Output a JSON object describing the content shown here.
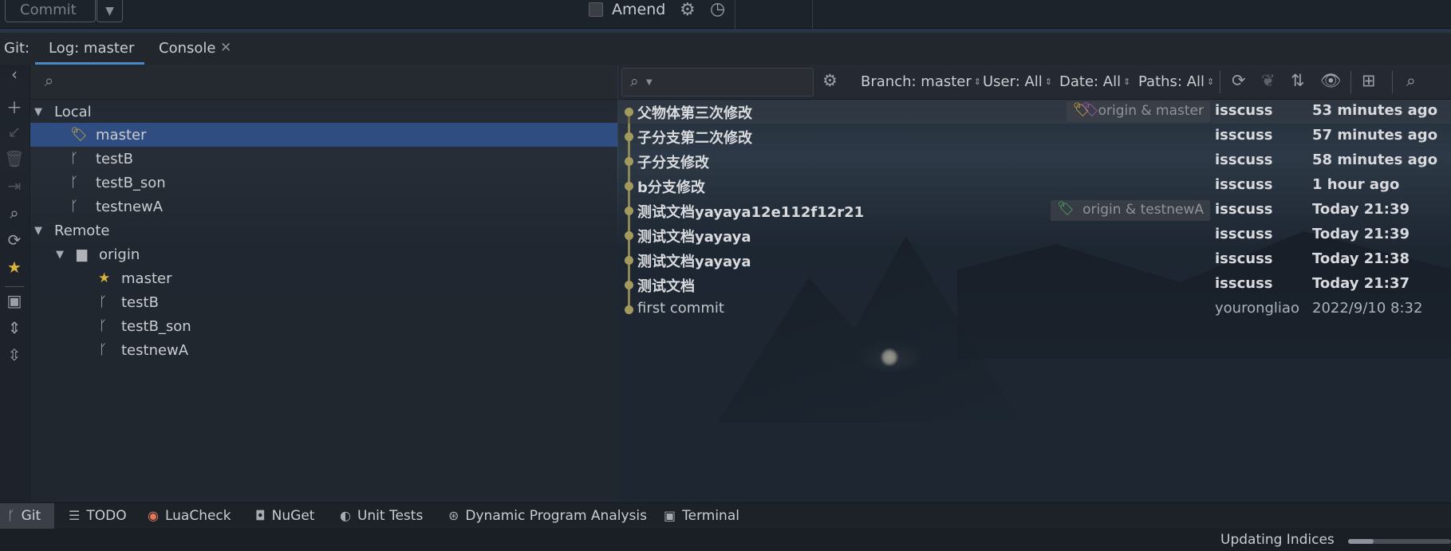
{
  "topbar": {
    "commit_label": "Commit",
    "amend_label": "Amend"
  },
  "tabs": {
    "git_label": "Git:",
    "items": [
      {
        "label": "Log: master",
        "active": true
      },
      {
        "label": "Console",
        "closable": true
      }
    ]
  },
  "branches": {
    "search_placeholder": "",
    "local_label": "Local",
    "local_items": [
      {
        "label": "master",
        "icon": "tag-icon",
        "selected": true
      },
      {
        "label": "testB",
        "icon": "branch-icon"
      },
      {
        "label": "testB_son",
        "icon": "branch-icon"
      },
      {
        "label": "testnewA",
        "icon": "branch-icon"
      }
    ],
    "remote_label": "Remote",
    "remote_group": "origin",
    "remote_items": [
      {
        "label": "master",
        "icon": "star-icon"
      },
      {
        "label": "testB",
        "icon": "branch-icon"
      },
      {
        "label": "testB_son",
        "icon": "branch-icon"
      },
      {
        "label": "testnewA",
        "icon": "branch-icon"
      }
    ]
  },
  "log_toolbar": {
    "branch_filter": "Branch: master",
    "user_filter": "User: All",
    "date_filter": "Date: All",
    "paths_filter": "Paths: All"
  },
  "commits": [
    {
      "message": "父物体第三次修改",
      "refs": "origin & master",
      "author": "isscuss",
      "date": "53 minutes ago",
      "bold": true
    },
    {
      "message": "子分支第二次修改",
      "refs": "",
      "author": "isscuss",
      "date": "57 minutes ago",
      "bold": true
    },
    {
      "message": "子分支修改",
      "refs": "",
      "author": "isscuss",
      "date": "58 minutes ago",
      "bold": true
    },
    {
      "message": "b分支修改",
      "refs": "",
      "author": "isscuss",
      "date": "1 hour ago",
      "bold": true
    },
    {
      "message": "测试文档yayaya12e112f12r21",
      "refs": "origin & testnewA",
      "author": "isscuss",
      "date": "Today 21:39",
      "bold": true
    },
    {
      "message": "测试文档yayaya",
      "refs": "",
      "author": "isscuss",
      "date": "Today 21:39",
      "bold": true
    },
    {
      "message": "测试文档yayaya",
      "refs": "",
      "author": "isscuss",
      "date": "Today 21:38",
      "bold": true
    },
    {
      "message": "测试文档",
      "refs": "",
      "author": "isscuss",
      "date": "Today 21:37",
      "bold": true
    },
    {
      "message": "first commit",
      "refs": "",
      "author": "yourongliao",
      "date": "2022/9/10 8:32",
      "bold": false
    }
  ],
  "bottom_tools": [
    {
      "label": "Git",
      "icon": "git-branch-icon",
      "active": true
    },
    {
      "label": "TODO",
      "icon": "list-icon"
    },
    {
      "label": "LuaCheck",
      "icon": "luacheck-icon"
    },
    {
      "label": "NuGet",
      "icon": "nuget-icon"
    },
    {
      "label": "Unit Tests",
      "icon": "unit-tests-icon"
    },
    {
      "label": "Dynamic Program Analysis",
      "icon": "analysis-icon"
    },
    {
      "label": "Terminal",
      "icon": "terminal-icon"
    }
  ],
  "status": {
    "text": "Updating Indices",
    "progress": 0.25
  },
  "colors": {
    "selection": "#2f4d80",
    "accent": "#4a88c7",
    "graph": "#a39a5e",
    "star": "#d9b23a"
  }
}
